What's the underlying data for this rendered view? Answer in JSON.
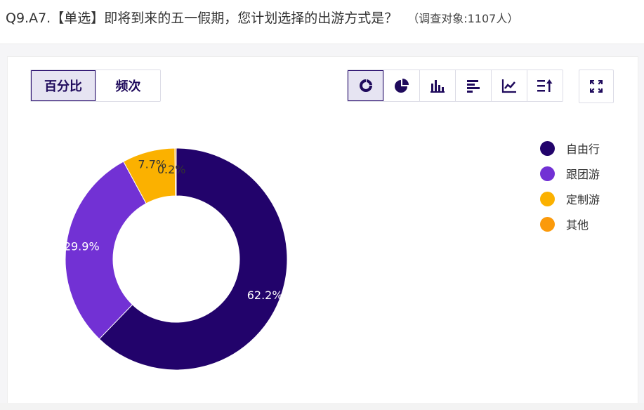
{
  "header": {
    "question": "Q9.A7.【单选】即将到来的五一假期，您计划选择的出游方式是？",
    "respondents": "（调查对象:1107人）"
  },
  "controls": {
    "modes": [
      {
        "label": "百分比",
        "active": true
      },
      {
        "label": "频次",
        "active": false
      }
    ],
    "chart_types": [
      {
        "icon": "donut-chart-icon",
        "active": true
      },
      {
        "icon": "pie-chart-icon",
        "active": false
      },
      {
        "icon": "column-chart-icon",
        "active": false
      },
      {
        "icon": "bar-chart-icon",
        "active": false
      },
      {
        "icon": "line-chart-icon",
        "active": false
      },
      {
        "icon": "sort-icon",
        "active": false
      }
    ],
    "expand_icon": "expand-icon"
  },
  "chart_data": {
    "type": "pie",
    "style": "donut",
    "categories": [
      "自由行",
      "跟团游",
      "定制游",
      "其他"
    ],
    "values": [
      62.2,
      29.9,
      7.7,
      0.2
    ],
    "value_labels": [
      "62.2%",
      "29.9%",
      "7.7%",
      "0.2%"
    ],
    "colors": [
      "#22036b",
      "#7231d4",
      "#fbb100",
      "#fb9a0b"
    ],
    "label_colors": [
      "#ffffff",
      "#ffffff",
      "#333333",
      "#333333"
    ],
    "legend_position": "right"
  }
}
